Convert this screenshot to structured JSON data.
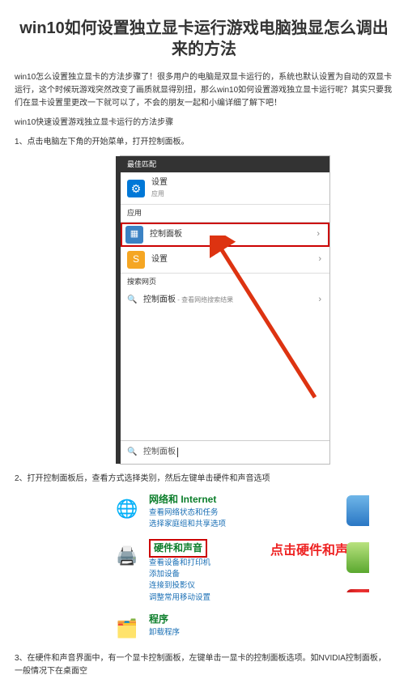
{
  "title": "win10如何设置独立显卡运行游戏电脑独显怎么调出来的方法",
  "intro": "win10怎么设置独立显卡的方法步骤了！很多用户的电脑是双显卡运行的，系统也默认设置为自动的双显卡运行，这个时候玩游戏突然改变了画质就显得别扭，那么win10如何设置游戏独立显卡运行呢？其实只要我们在显卡设置里更改一下就可以了，不会的朋友一起和小编详细了解下吧！",
  "subhead": "win10快速设置游戏独立显卡运行的方法步骤",
  "step1": "1、点击电脑左下角的开始菜单，打开控制面板。",
  "step2": "2、打开控制面板后，查看方式选择类别，然后左键单击硬件和声音选项",
  "step3": "3、在硬件和声音界面中，有一个显卡控制面板，左键单击一显卡的控制面板选项。如NVIDIA控制面板，一般情况下在桌面空",
  "startmenu": {
    "best_match": "最佳匹配",
    "settings": {
      "label": "设置",
      "sub": "应用"
    },
    "apps_header": "应用",
    "control_panel": "控制面板",
    "settings2": "设置",
    "search_web": "搜索网页",
    "web_item": "控制面板",
    "web_sub": " - 查看网络搜索结果",
    "input": "控制面板"
  },
  "cpanel": {
    "net": {
      "title": "网络和 Internet",
      "l1": "查看网络状态和任务",
      "l2": "选择家庭组和共享选项"
    },
    "hw": {
      "title": "硬件和声音",
      "l1": "查看设备和打印机",
      "l2": "添加设备",
      "l3": "连接到投影仪",
      "l4": "调整常用移动设置"
    },
    "prog": {
      "title": "程序",
      "l1": "卸载程序"
    },
    "callout": "点击硬件和声音"
  }
}
